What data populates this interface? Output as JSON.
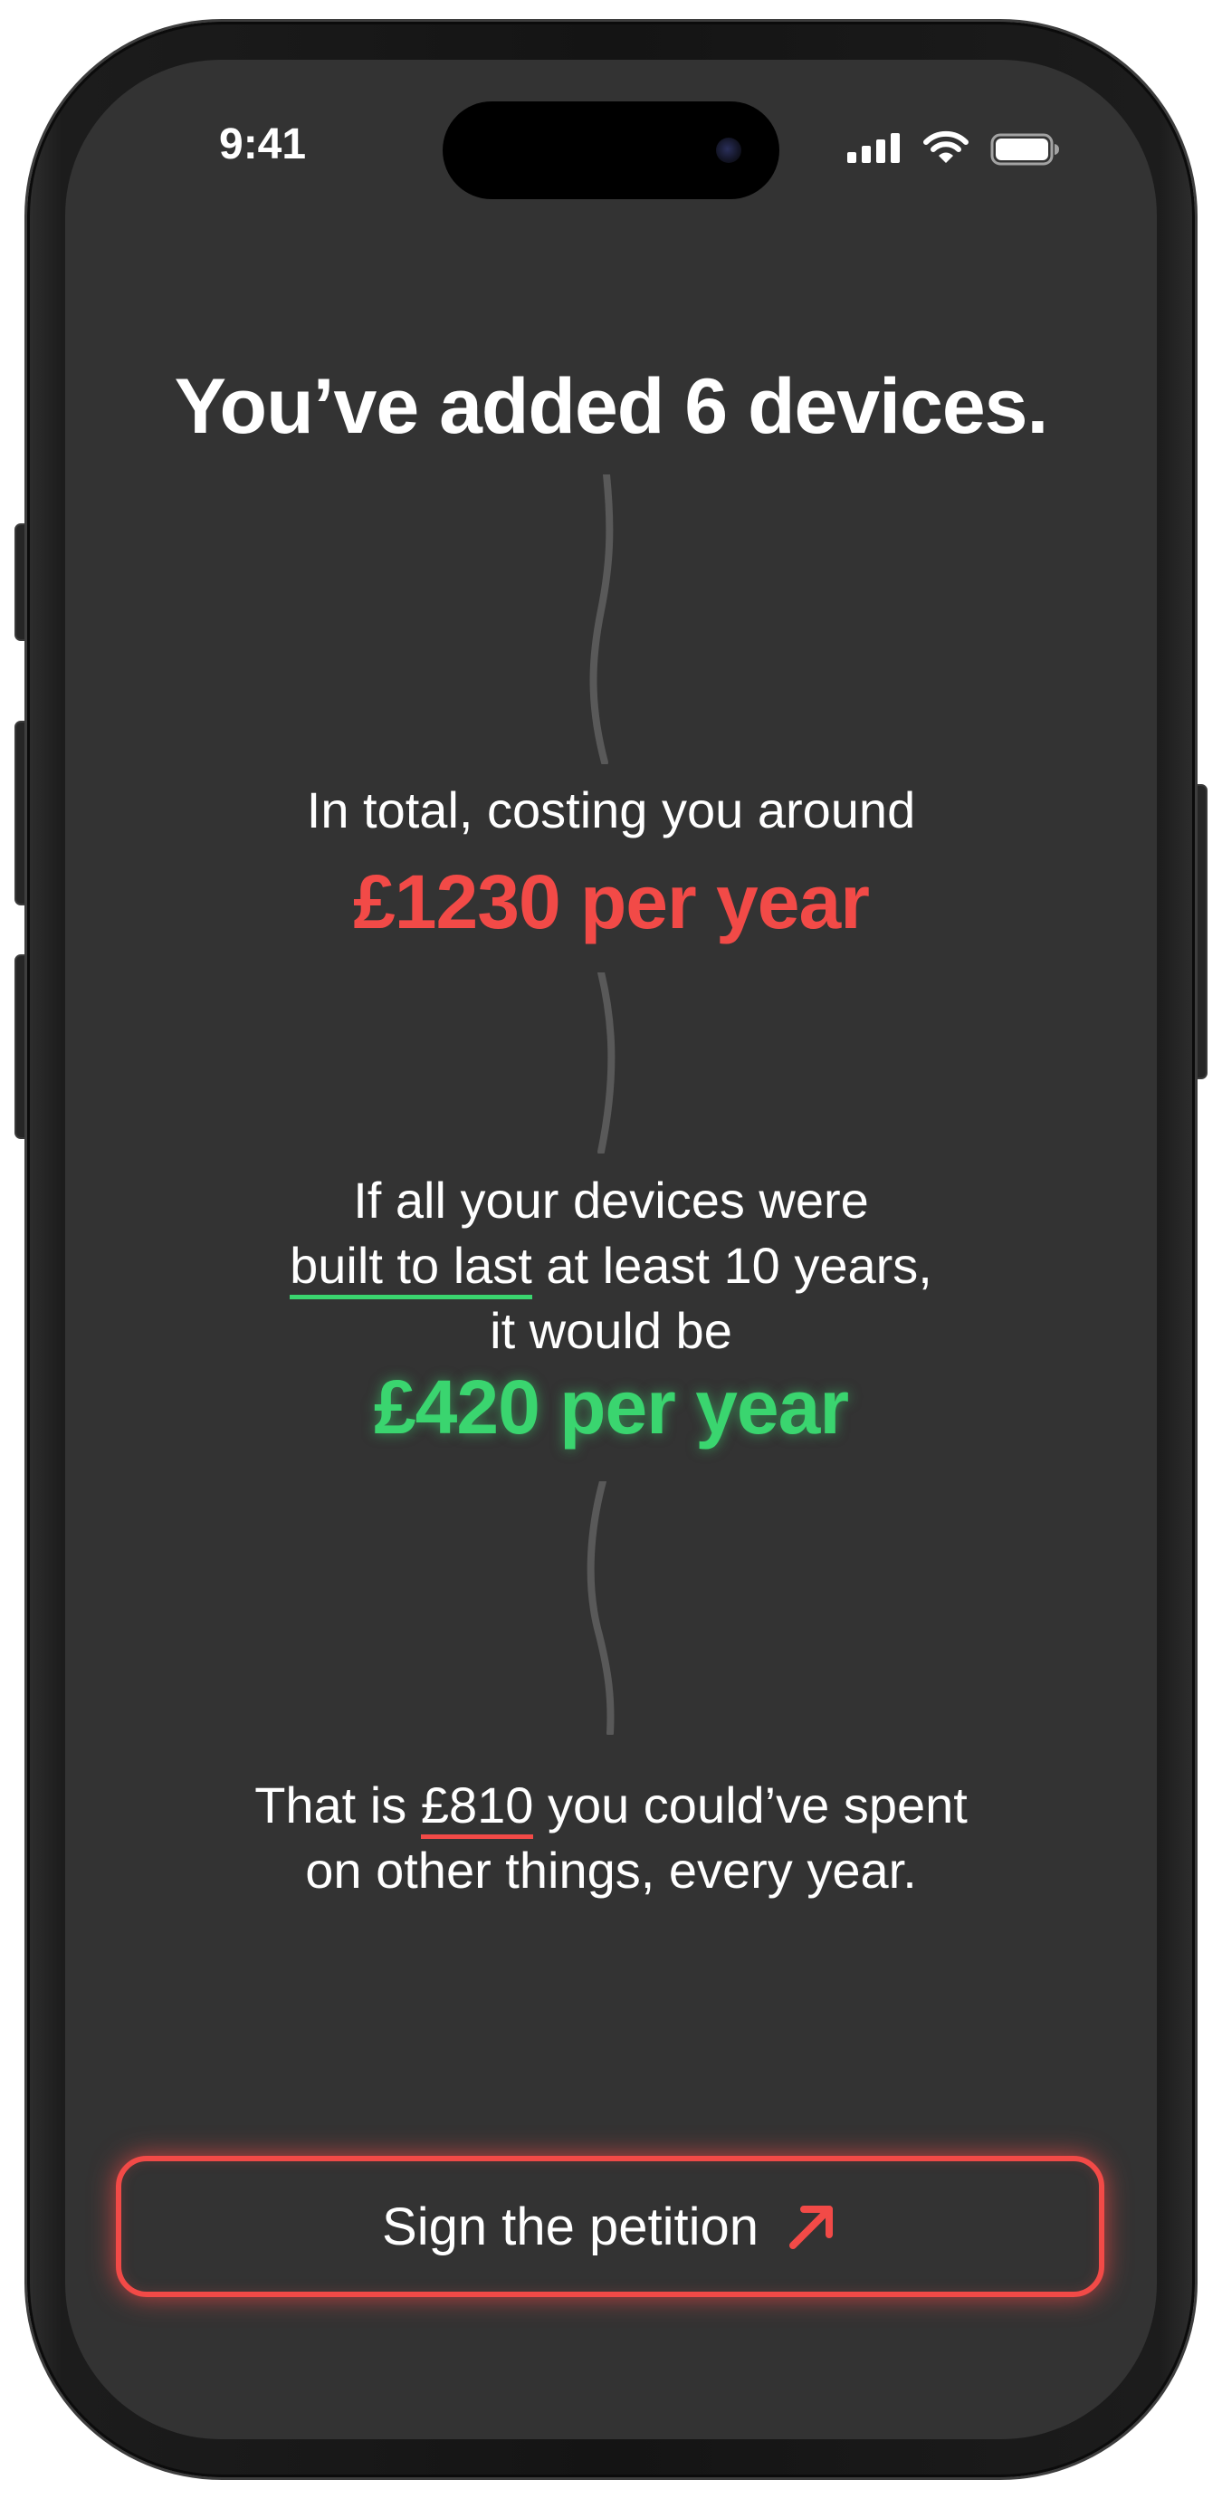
{
  "status_bar": {
    "time": "9:41"
  },
  "summary": {
    "headline": "You’ve added 6 devices.",
    "total_line": "In total, costing you around",
    "total_amount": "£1230 per year",
    "comparison_line_1": "If all your devices were",
    "comparison_underlined": "built to last",
    "comparison_line_2_rest": " at least 10 years,",
    "comparison_line_3": "it would be",
    "comparison_amount": "£420 per year",
    "savings_prefix": "That is ",
    "savings_amount": "£810",
    "savings_suffix": " you could’ve spent",
    "savings_line_2": "on other things, every year."
  },
  "cta": {
    "label": "Sign the petition",
    "icon": "arrow-up-right-icon"
  },
  "colors": {
    "screen_bg": "#333333",
    "cost_red": "#f24a47",
    "saving_green": "#3ad56f",
    "text": "#ffffff",
    "squiggle": "#595959"
  }
}
